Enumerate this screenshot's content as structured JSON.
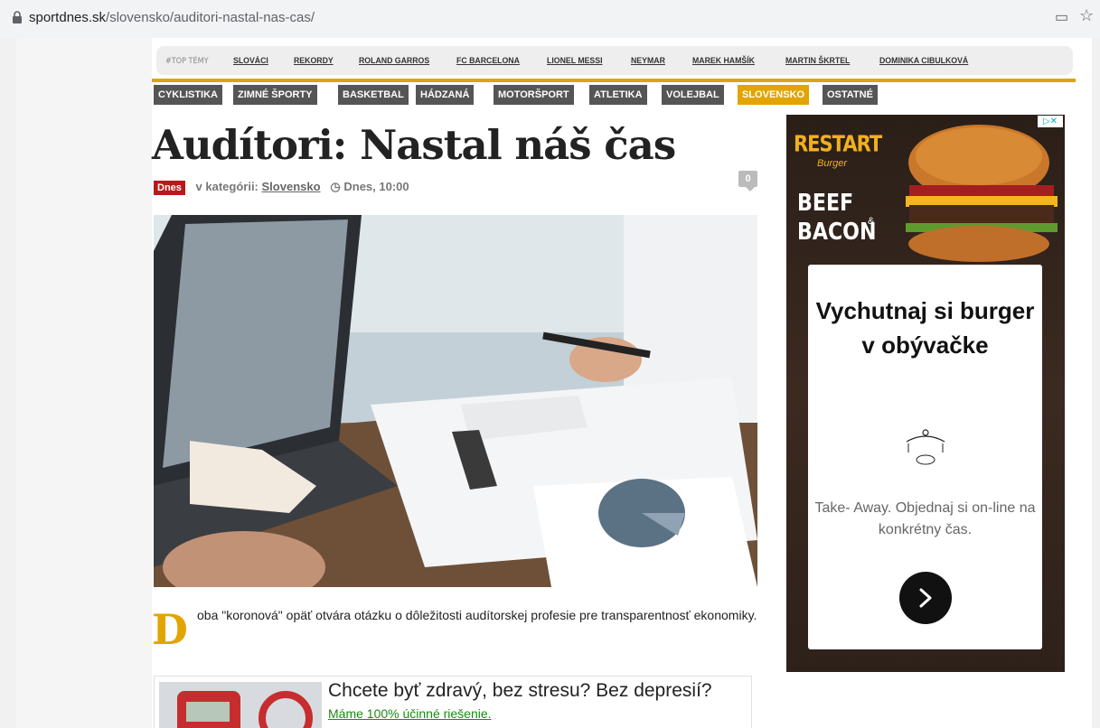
{
  "browser": {
    "url_host": "sportdnes.sk",
    "url_path": "/slovensko/auditori-nastal-nas-cas/"
  },
  "topics": {
    "label": "#TOP TÉMY",
    "items": [
      "SLOVÁCI",
      "REKORDY",
      "ROLAND GARROS",
      "FC BARCELONA",
      "LIONEL MESSI",
      "NEYMAR",
      "MAREK HAMŠÍK",
      "MARTIN ŠKRTEL",
      "DOMINIKA CIBULKOVÁ"
    ]
  },
  "categories": [
    "CYKLISTIKA",
    "ZIMNÉ ŠPORTY",
    "BASKETBAL",
    "HÁDZANÁ",
    "MOTORŠPORT",
    "ATLETIKA",
    "VOLEJBAL",
    "SLOVENSKO",
    "OSTATNÉ"
  ],
  "active_category": "SLOVENSKO",
  "article": {
    "title": "Audítori: Nastal náš čas",
    "badge": "Dnes",
    "category_prefix": "v kategórii:",
    "category": "Slovensko",
    "time": "Dnes, 10:00",
    "comments": "0",
    "dropcap": "D",
    "lead": "oba \"koronová\" opäť otvára otázku o dôležitosti audítorskej profesie pre transparentnosť ekonomiky."
  },
  "promo": {
    "title": "Chcete byť zdravý, bez stresu? Bez depresií?",
    "link": "Máme 100% účinné riešenie."
  },
  "ad": {
    "brand": "RESTART",
    "brand_sub": "Burger",
    "line1": "BEEF",
    "amp": "&",
    "line2": "BACON",
    "headline": "Vychutnaj si burger v obývačke",
    "text": "Take- Away. Objednaj si on-line na konkrétny čas.",
    "adchoices": "▷✕"
  },
  "colors": {
    "accent": "#e3a400",
    "badge": "#b8191a",
    "category_bg": "#555555",
    "link_green": "#1a8a14"
  }
}
